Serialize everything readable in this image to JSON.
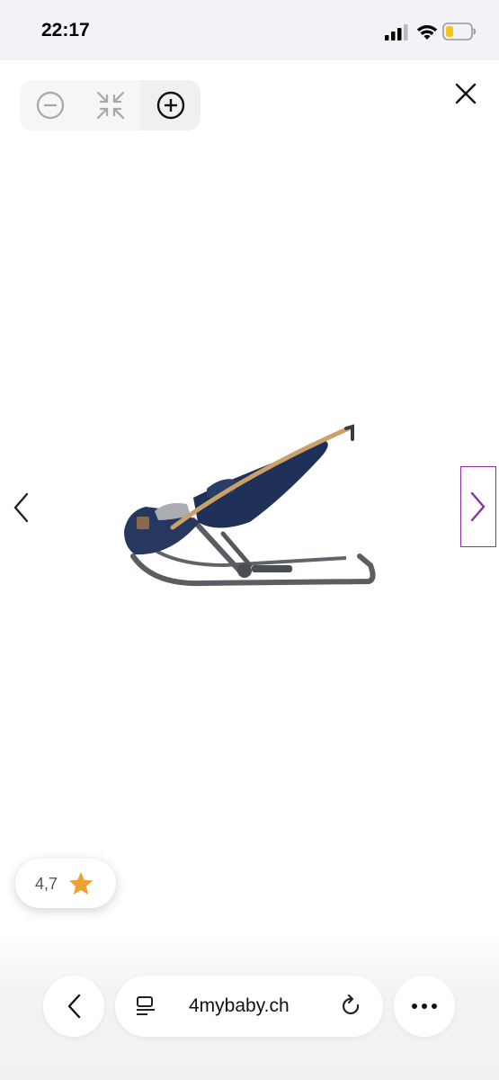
{
  "status_bar": {
    "time": "22:17",
    "icons": [
      "cellular-signal-icon",
      "wifi-icon",
      "battery-icon"
    ],
    "battery_color": "#f5c518"
  },
  "viewer": {
    "toolbar": [
      "zoom-out-icon",
      "fit-screen-icon",
      "zoom-in-icon"
    ],
    "close": "close-icon",
    "prev": "chevron-left-icon",
    "next": "chevron-right-icon",
    "accent": "#8a2fa8"
  },
  "rating": {
    "value": "4,7",
    "star_color": "#f0a030"
  },
  "browser": {
    "url": "4mybaby.ch",
    "back": "back-icon",
    "reader": "reader-icon",
    "reload": "reload-icon",
    "more": "more-icon"
  }
}
